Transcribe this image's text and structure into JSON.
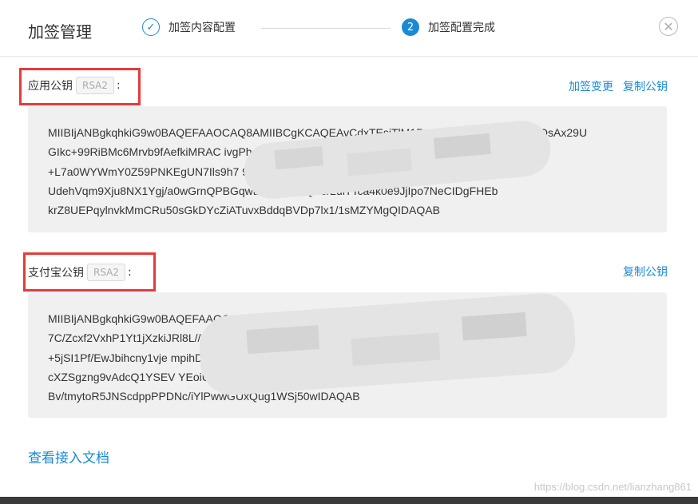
{
  "dialog": {
    "title": "加签管理",
    "steps": [
      {
        "number": "✓",
        "label": "加签内容配置"
      },
      {
        "number": "2",
        "label": "加签配置完成"
      }
    ],
    "close_icon": "close-circle-icon"
  },
  "app_key": {
    "label": "应用公钥",
    "badge": "RSA2",
    "colon": ":",
    "actions": [
      "加签变更",
      "复制公钥"
    ],
    "lines": [
      "MIIBIjANBgkqhkiG9w0BAQEFAAOCAQ8AMIIBCgKCAQEAvCdxTEsiTlM1RgIoEq/LFzXqGwJ3rieLIQsAx29U",
      "GIkc+99RiBMc6Mrvb9fAefkiMRAC                                                    ivgPh4tXUvIsOfDZBrgQ",
      "+L7a0WYWmY0Z59PNKEgUN7Ils9h7                                                   95WPSrWeVUvlSCWnD",
      "UdehVqm9Xju8NX1Ygj/a0wGrnQPBGqwtlMiMia9F                              QP5/2ulTTca4k0e9JjIpo7NeCIDgFHEb",
      "krZ8UEPqylnvkMmCRu50sGkDYcZiATuvxBddqBVDp7lx1/1sMZYMgQIDAQAB"
    ]
  },
  "alipay_key": {
    "label": "支付宝公钥",
    "badge": "RSA2",
    "colon": ":",
    "actions": [
      "复制公钥"
    ],
    "lines": [
      "MIIBIjANBgkqhkiG9w0BAQEFAAOCAQ8AMIIBCgKC                                       qStf5tzKni9Tx1mhev5HdVZ",
      "7C/Zcxf2VxhP1Yt1jXzkiJRl8L//3MGS2mB                                             Nu9w2Se6cgG5kR",
      "+5jSI1Pf/EwJbihcny1vje                                                           mpihD7Bx6Sl6t6+/",
      "cXZSgzng9vAdcQ1YSEV                                                             YEoiUu6cmZO27PtjIL78A",
      "Bv/tmytoR5JNScdppPPDNc/iYlPwwGUxQug1WSj50wIDAQAB"
    ]
  },
  "footer": {
    "doc_link": "查看接入文档",
    "watermark": "https://blog.csdn.net/lianzhang861"
  }
}
